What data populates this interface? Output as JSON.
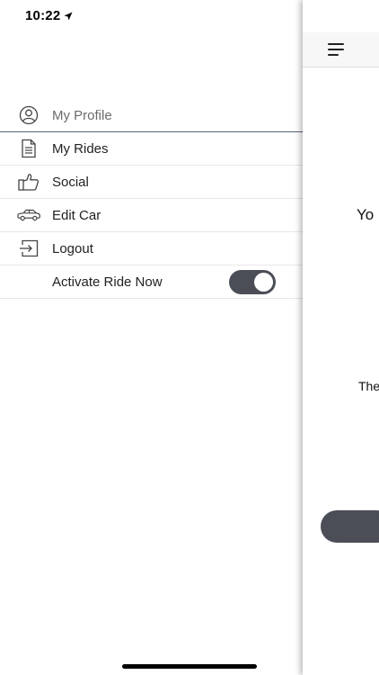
{
  "status_bar": {
    "time": "10:22",
    "location_icon": "location-arrow-icon",
    "signal_icon": "cellular-signal-icon",
    "wifi_icon": "wifi-icon",
    "battery_icon": "battery-icon"
  },
  "drawer": {
    "items": [
      {
        "label": "My Profile",
        "icon": "user-circle-icon"
      },
      {
        "label": "My Rides",
        "icon": "document-icon"
      },
      {
        "label": "Social",
        "icon": "thumbs-up-icon"
      },
      {
        "label": "Edit Car",
        "icon": "car-icon"
      },
      {
        "label": "Logout",
        "icon": "logout-icon"
      }
    ],
    "activate_ride": {
      "label": "Activate Ride Now",
      "enabled": true
    }
  },
  "main_panel": {
    "menu_icon": "hamburger-menu-icon",
    "text_1": "Yo",
    "text_2": "The"
  },
  "colors": {
    "toggle_on": "#4b4e57",
    "button": "#4b4e57",
    "active_divider": "#5a6378"
  }
}
